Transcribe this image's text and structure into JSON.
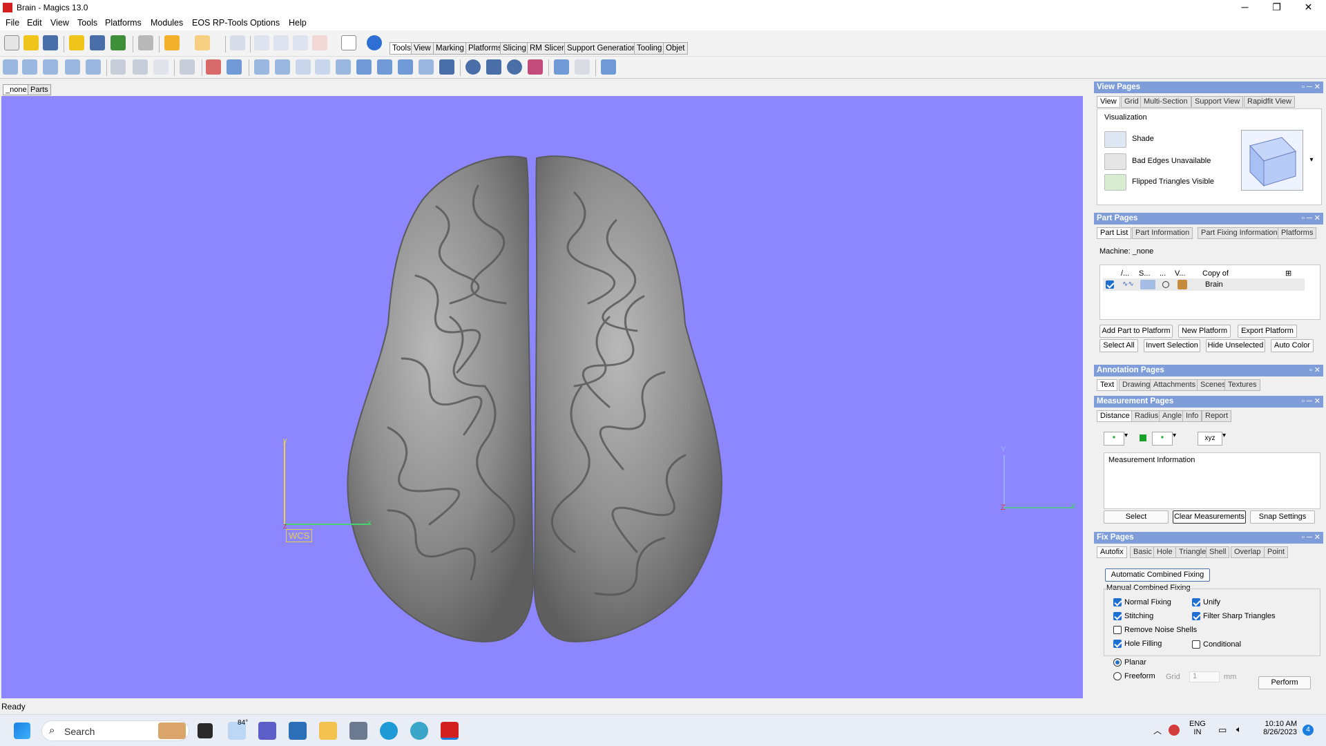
{
  "window": {
    "title": "Brain - Magics 13.0",
    "minimize": "─",
    "maximize": "❐",
    "close": "✕"
  },
  "menu": [
    "File",
    "Edit",
    "View",
    "Tools",
    "Platforms",
    "Modules",
    "EOS RP-Tools",
    "Options",
    "Help"
  ],
  "toolbar_tabs": [
    {
      "label": "Tools",
      "active": true
    },
    {
      "label": "View"
    },
    {
      "label": "Marking"
    },
    {
      "label": "Platforms"
    },
    {
      "label": "Slicing"
    },
    {
      "label": "RM Slicer"
    },
    {
      "label": "Support Generation"
    },
    {
      "label": "Tooling"
    },
    {
      "label": "Objet"
    }
  ],
  "viewport_tabs": [
    {
      "label": "_none",
      "active": true
    },
    {
      "label": "Parts"
    }
  ],
  "viewport": {
    "background": "#8c87ff",
    "wcs_label": "WCS",
    "axis_y_left": "y",
    "axis_z_left": "z",
    "axis_x_left": "x",
    "axis_y_right": "Y",
    "axis_z_right": "Z",
    "axis_x_right": "X"
  },
  "view_pages": {
    "title": "View Pages",
    "tabs": [
      "View",
      "Grid",
      "Multi-Section",
      "Support View",
      "Rapidfit View"
    ],
    "group": "Visualization",
    "items": [
      "Shade",
      "Bad Edges Unavailable",
      "Flipped Triangles Visible"
    ]
  },
  "part_pages": {
    "title": "Part Pages",
    "tabs": [
      "Part List",
      "Part Information",
      "Part Fixing Information",
      "Platforms"
    ],
    "machine": "Machine: _none",
    "columns": [
      "/...",
      "S...",
      "...",
      "V...",
      "Copy of"
    ],
    "rows": [
      {
        "name": "Brain"
      }
    ],
    "buttons_row1": [
      "Add Part to Platform",
      "New Platform",
      "Export Platform"
    ],
    "buttons_row2": [
      "Select All",
      "Invert Selection",
      "Hide Unselected",
      "Auto Color"
    ]
  },
  "annotation_pages": {
    "title": "Annotation Pages",
    "tabs": [
      "Text",
      "Drawing",
      "Attachments",
      "Scenes",
      "Textures"
    ]
  },
  "measurement_pages": {
    "title": "Measurement Pages",
    "tabs": [
      "Distance",
      "Radius",
      "Angle",
      "Info",
      "Report"
    ],
    "xyz_label": "xyz",
    "info_label": "Measurement Information",
    "buttons": [
      "Select",
      "Clear Measurements",
      "Snap Settings"
    ]
  },
  "fix_pages": {
    "title": "Fix Pages",
    "tabs": [
      "Autofix",
      "Basic",
      "Hole",
      "Triangle",
      "Shell",
      "Overlap",
      "Point"
    ],
    "auto_button": "Automatic Combined Fixing",
    "manual_label": "Manual Combined Fixing",
    "options": [
      {
        "label": "Normal Fixing",
        "checked": true
      },
      {
        "label": "Unify",
        "checked": true
      },
      {
        "label": "Stitching",
        "checked": true
      },
      {
        "label": "Filter Sharp Triangles",
        "checked": true
      },
      {
        "label": "Remove Noise Shells",
        "checked": false
      },
      {
        "label": "Hole Filling",
        "checked": true
      },
      {
        "label": "Conditional",
        "checked": false
      }
    ],
    "mode_planar": "Planar",
    "mode_freeform": "Freeform",
    "grid_label": "Grid",
    "grid_value": "1",
    "grid_unit": "mm",
    "perform": "Perform"
  },
  "status": "Ready",
  "taskbar": {
    "search": "Search",
    "weather": "84°",
    "lang1": "ENG",
    "lang2": "IN",
    "time": "10:10 AM",
    "date": "8/26/2023",
    "notifications": "4"
  }
}
